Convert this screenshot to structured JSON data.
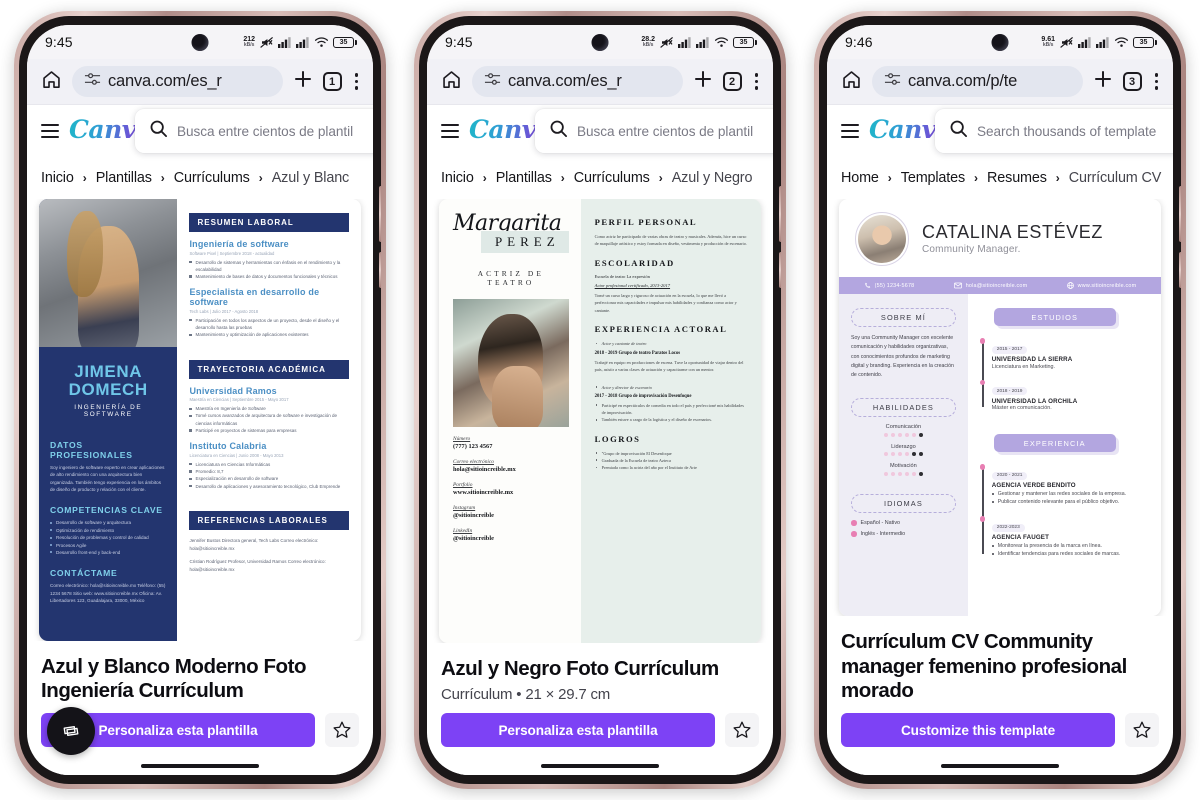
{
  "phones": [
    {
      "status": {
        "time": "9:45",
        "net_speed_value": "212",
        "net_speed_unit": "kB/s",
        "battery_level": "35"
      },
      "browser": {
        "url": "canva.com/es_r",
        "tab_count": "1"
      },
      "app": {
        "search_placeholder": "Busca entre cientos de plantil",
        "logo_text": "Canva"
      },
      "breadcrumb": [
        "Inicio",
        "Plantillas",
        "Currículums",
        "Azul y Blanc"
      ],
      "template": {
        "title": "Azul y Blanco Moderno Foto Ingeniería Currículum",
        "subtitle": "",
        "cta": "Personaliza esta plantilla"
      },
      "resume": {
        "kind": "blue-white",
        "first_name": "JIMENA",
        "last_name": "DOMECH",
        "role": "INGENIERÍA DE SOFTWARE",
        "left_sections": [
          {
            "heading": "DATOS PROFESIONALES",
            "paragraph": "Soy ingeniero de software experto en crear aplicaciones de alto rendimiento con una arquitectura bien organizada. También tengo experiencia en los ámbitos de diseño de producto y relación con el cliente."
          },
          {
            "heading": "COMPETENCIAS CLAVE",
            "items": [
              "Desarrollo de software y arquitectura",
              "Optimización de rendimiento",
              "Resolución de problemas y control de calidad",
              "Procesos Agile",
              "Desarrollo front-end y back-end"
            ]
          },
          {
            "heading": "CONTÁCTAME",
            "paragraph": "Correo electrónico: hola@sitioincreible.mx Teléfono: (55) 1234 5678 Sitio web: www.sitioincreible.mx Oficina: Av. Libertadores 123, Guadalajara, 33000, México"
          }
        ],
        "right_sections": [
          {
            "bar": "RESUMEN LABORAL",
            "entries": [
              {
                "title": "Ingeniería de software",
                "meta": "Software Pixel | Septiembre 2018 - actualidad",
                "items": [
                  "Desarrollo de sistemas y herramientas con énfasis en el rendimiento y la escalabilidad",
                  "Mantenimiento de bases de datos y documentos funcionales y técnicos"
                ]
              },
              {
                "title": "Especialista en desarrollo de software",
                "meta": "Tech Labs | Julio 2017 - Agosto 2018",
                "items": [
                  "Participación en todos los aspectos de un proyecto, desde el diseño y el desarrollo hasta las pruebas",
                  "Mantenimiento y optimización de aplicaciones existentes"
                ]
              }
            ]
          },
          {
            "bar": "TRAYECTORIA ACADÉMICA",
            "entries": [
              {
                "title": "Universidad Ramos",
                "meta": "Maestría en Ciencias | Septiembre 2015 - Mayo 2017",
                "items": [
                  "Maestría en Ingeniería de Software",
                  "Tomé cursos avanzados de arquitectura de software e investigación de ciencias informáticas",
                  "Participé en proyectos de sistemas para empresas"
                ]
              },
              {
                "title": "Instituto Calabria",
                "meta": "Licenciatura en Ciencias | Junio 2008 - Mayo 2013",
                "items": [
                  "Licenciatura en Ciencias Informáticas",
                  "Promedio: 8,7",
                  "Especialización en desarrollo de software",
                  "Desarrollo de aplicaciones y asesoramiento tecnológico, Club Emprende"
                ]
              }
            ]
          },
          {
            "bar": "REFERENCIAS LABORALES",
            "references": [
              "Jennifer Bustos\nDirectora general, Tech Labs\nCorreo electrónico: hola@sitioincreible.mx",
              "Cristian Rodríguez\nProfesor, Universidad Ramos Correo electrónico: hola@sitioincreible.mx"
            ]
          }
        ]
      }
    },
    {
      "status": {
        "time": "9:45",
        "net_speed_value": "28.2",
        "net_speed_unit": "kB/s",
        "battery_level": "35"
      },
      "browser": {
        "url": "canva.com/es_r",
        "tab_count": "2"
      },
      "app": {
        "search_placeholder": "Busca entre cientos de plantil",
        "logo_text": "Canva"
      },
      "breadcrumb": [
        "Inicio",
        "Plantillas",
        "Currículums",
        "Azul y Negro"
      ],
      "template": {
        "title": "Azul y Negro Foto Currículum",
        "subtitle": "Currículum • 21 × 29.7 cm",
        "cta": "Personaliza esta plantilla"
      },
      "resume": {
        "kind": "margarita",
        "first_name": "Margarita",
        "last_name": "PEREZ",
        "role": "ACTRIZ DE TEATRO",
        "contacts": [
          {
            "label": "Número",
            "value": "(777) 123 4567"
          },
          {
            "label": "Correo electrónico",
            "value": "hola@sitioincreible.mx"
          },
          {
            "label": "Portfolio",
            "value": "www.sitioincreible.mx"
          },
          {
            "label": "Instagram",
            "value": "@sitioincreible"
          },
          {
            "label": "LinkedIn",
            "value": "@sitioincreible"
          }
        ],
        "sections": [
          {
            "heading": "PERFIL PERSONAL",
            "paragraph": "Como actriz he participado de varias obras de teatro y musicales. Además, hice un curso de maquillaje artístico y estoy formada en diseño, vestimenta y producción de escenario."
          },
          {
            "heading": "ESCOLARIDAD",
            "sub": "Escuela de teatro La expresión",
            "em": "Actor profesional certificado, 2013-2017",
            "paragraph": "Tomé un curso largo y riguroso de actuación en la escuela, lo que me llevó a perfeccionar mis capacidades e impulsar mis habilidades y confianza como actor y cantante."
          },
          {
            "heading": "EXPERIENCIA ACTORAL",
            "jobs": [
              {
                "role_line": "Actor y cantante de teatro",
                "title": "2018 - 2019  Grupo de teatro Paratos Locos",
                "paragraph": "Trabajé en equipo en producciones de escena. Tuve la oportunidad de viajar dentro del país, asistir a varias clases de actuación y capacitarme con un mentor."
              },
              {
                "role_line": "Actor y director de escenario",
                "title": "2017 - 2018  Grupo de improvisación Desenfoque",
                "items": [
                  "Participé en espectáculos de comedia en todo el país y perfeccioné mis habilidades de improvisación.",
                  "También estuve a cargo de la logística y el diseño de escenarios."
                ]
              }
            ]
          },
          {
            "heading": "LOGROS",
            "items": [
              "\"Grupo de improvisación El Desenfoque",
              "Graduada de la Escuela de teatro Azteca",
              "Premiada como la actriz del año por el Instituto de Arte"
            ]
          }
        ]
      }
    },
    {
      "status": {
        "time": "9:46",
        "net_speed_value": "9.61",
        "net_speed_unit": "kB/s",
        "battery_level": "35"
      },
      "browser": {
        "url": "canva.com/p/te",
        "tab_count": "3"
      },
      "app": {
        "search_placeholder": "Search thousands of template",
        "logo_text": "Canva"
      },
      "breadcrumb": [
        "Home",
        "Templates",
        "Resumes",
        "Currículum CV"
      ],
      "template": {
        "title": "Currículum CV Community manager femenino profesional morado",
        "subtitle": "",
        "cta": "Customize this template"
      },
      "resume": {
        "kind": "purple-cv",
        "name": "CATALINA ESTÉVEZ",
        "role": "Community Manager.",
        "contacts": [
          {
            "icon": "phone-icon",
            "text": "(55) 1234-5678"
          },
          {
            "icon": "mail-icon",
            "text": "hola@sitioincreible.com"
          },
          {
            "icon": "globe-icon",
            "text": "www.sitioincreible.com"
          }
        ],
        "about_heading": "SOBRE MÍ",
        "about_text": "Soy una Community Manager con excelente comunicación y habilidades organizativas, con conocimientos profundos de marketing digital y branding. Experiencia en la creación de contenido.",
        "skills_heading": "HABILIDADES",
        "skills": [
          {
            "name": "Comunicación",
            "filled": 5,
            "total": 6
          },
          {
            "name": "Liderazgo",
            "filled": 4,
            "total": 6
          },
          {
            "name": "Motivación",
            "filled": 5,
            "total": 6
          }
        ],
        "languages_heading": "IDIOMAS",
        "languages": [
          "Español - Nativo",
          "Inglés - Intermedio"
        ],
        "education_heading": "ESTUDIOS",
        "education": [
          {
            "years": "2015 - 2017",
            "org": "UNIVERSIDAD LA SIERRA",
            "detail": "Licenciatura en Marketing."
          },
          {
            "years": "2018 - 2019",
            "org": "UNIVERSIDAD LA ORCHILA",
            "detail": "Máster en comunicación."
          }
        ],
        "experience_heading": "EXPERIENCIA",
        "experience": [
          {
            "years": "2020 - 2021",
            "org": "AGENCIA VERDE BENDITO",
            "items": [
              "Gestionar y mantener las redes sociales de la empresa.",
              "Publicar contenido relevante para el público objetivo."
            ]
          },
          {
            "years": "2022-2023",
            "org": "AGENCIA FAUGET",
            "items": [
              "Monitorear la presencia de la marca en línea.",
              "Identificar tendencias para redes sociales de marcas."
            ]
          }
        ]
      }
    }
  ],
  "colors": {
    "canva_purple": "#7d42f5",
    "resume1_navy": "#23356f",
    "resume1_lightblue": "#6fc6e8",
    "resume2_mint": "#e7efeb",
    "resume3_lavender": "#b3a6e0",
    "resume3_pink": "#e87fb3",
    "phone_bezel": "#caa9a4"
  }
}
